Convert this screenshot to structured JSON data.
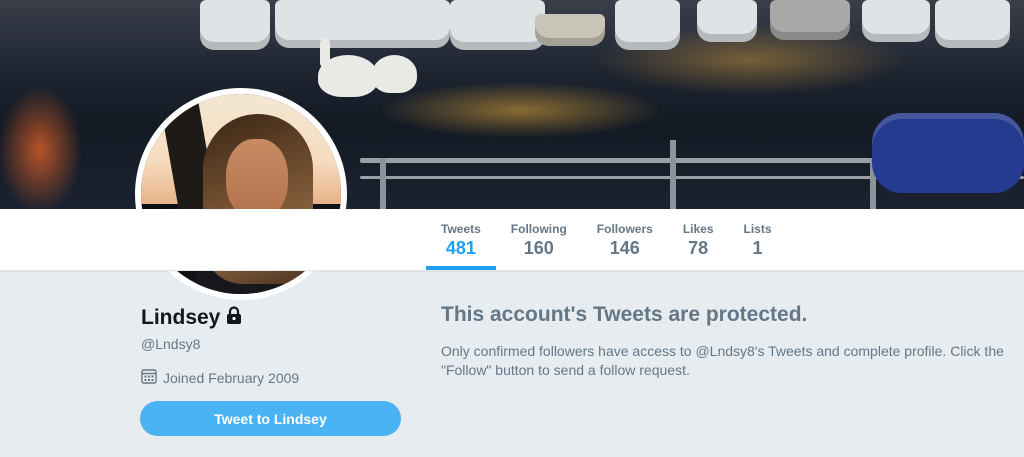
{
  "profile": {
    "name": "Lindsey",
    "handle": "@Lndsy8",
    "joined": "Joined February 2009",
    "tweet_button_label": "Tweet to Lindsey",
    "lock_icon": "lock-icon",
    "calendar_icon": "calendar-icon"
  },
  "stats": [
    {
      "label": "Tweets",
      "value": "481",
      "active": true
    },
    {
      "label": "Following",
      "value": "160",
      "active": false
    },
    {
      "label": "Followers",
      "value": "146",
      "active": false
    },
    {
      "label": "Likes",
      "value": "78",
      "active": false
    },
    {
      "label": "Lists",
      "value": "1",
      "active": false
    }
  ],
  "protected": {
    "title": "This account's Tweets are protected.",
    "body": "Only confirmed followers have access to @Lndsy8's Tweets and complete profile. Click the \"Follow\" button to send a follow request."
  },
  "colors": {
    "accent": "#1da1f2",
    "button": "#4ab3f4",
    "muted_text": "#657786",
    "page_bg": "#e6ecf0"
  }
}
